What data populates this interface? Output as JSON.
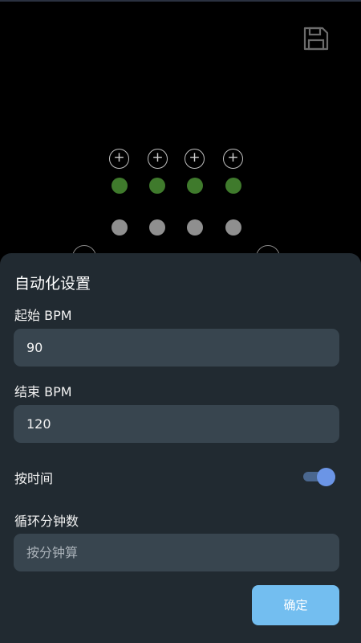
{
  "grid": {
    "plus_symbol": "+",
    "columns": 4
  },
  "sheet": {
    "title": "自动化设置",
    "start_bpm": {
      "label": "起始 BPM",
      "value": "90"
    },
    "end_bpm": {
      "label": "结束 BPM",
      "value": "120"
    },
    "by_time": {
      "label": "按时间",
      "enabled": true
    },
    "cycle_minutes": {
      "label": "循环分钟数",
      "placeholder": "按分钟算"
    },
    "confirm_label": "确定"
  },
  "colors": {
    "background": "#000000",
    "sheet": "#212a31",
    "field": "#38454f",
    "active_dot": "#3f7a2c",
    "inactive_dot": "#8f8f8f",
    "toggle_thumb": "#6b95e6",
    "confirm_button": "#73bef0"
  },
  "icons": {
    "save": "floppy-disk-icon",
    "add": "plus-circle-icon"
  }
}
